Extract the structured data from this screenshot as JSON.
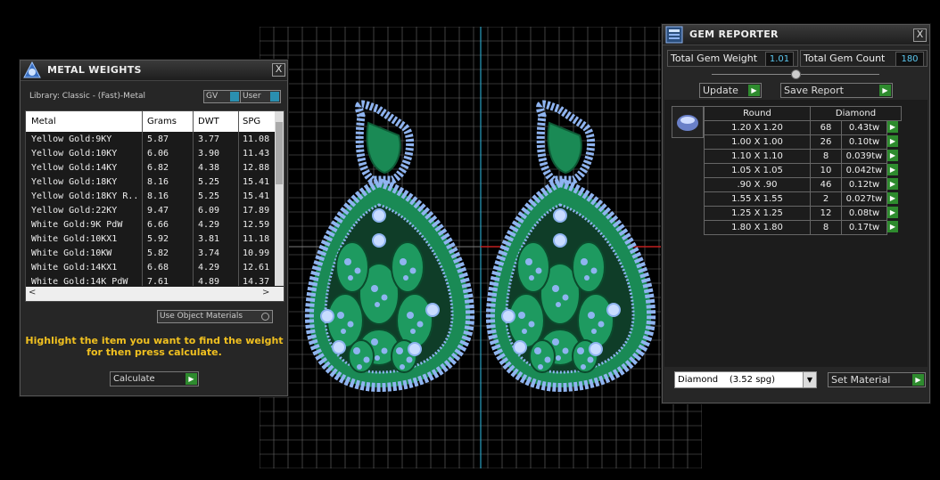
{
  "metal_weights": {
    "title": "METAL WEIGHTS",
    "close": "X",
    "library": "Library: Classic - (Fast)-Metal",
    "toggle_gv": "GV",
    "toggle_user": "User",
    "headers": [
      "Metal",
      "Grams",
      "DWT",
      "SPG"
    ],
    "rows": [
      [
        "Yellow Gold:9KY",
        "5.87",
        "3.77",
        "11.08"
      ],
      [
        "Yellow Gold:10KY",
        "6.06",
        "3.90",
        "11.43"
      ],
      [
        "Yellow Gold:14KY",
        "6.82",
        "4.38",
        "12.88"
      ],
      [
        "Yellow Gold:18KY",
        "8.16",
        "5.25",
        "15.41"
      ],
      [
        "Yellow Gold:18KY R...",
        "8.16",
        "5.25",
        "15.41"
      ],
      [
        "Yellow Gold:22KY",
        "9.47",
        "6.09",
        "17.89"
      ],
      [
        "White Gold:9K PdW",
        "6.66",
        "4.29",
        "12.59"
      ],
      [
        "White Gold:10KX1",
        "5.92",
        "3.81",
        "11.18"
      ],
      [
        "White Gold:10KW",
        "5.82",
        "3.74",
        "10.99"
      ],
      [
        "White Gold:14KX1",
        "6.68",
        "4.29",
        "12.61"
      ],
      [
        "White Gold:14K PdW",
        "7.61",
        "4.89",
        "14.37"
      ]
    ],
    "use_object_materials": "Use Object Materials",
    "hint_line1": "Highlight the item you want to find the weight",
    "hint_line2": "for then press calculate.",
    "calculate": "Calculate"
  },
  "gem_reporter": {
    "title": "GEM REPORTER",
    "close": "X",
    "total_weight_label": "Total Gem Weight",
    "total_weight_value": "1.01",
    "total_count_label": "Total Gem Count",
    "total_count_value": "180",
    "update": "Update",
    "save_report": "Save Report",
    "header_shape": "Round",
    "header_material": "Diamond",
    "rows": [
      [
        "1.20 X 1.20",
        "68",
        "0.43tw"
      ],
      [
        "1.00 X 1.00",
        "26",
        "0.10tw"
      ],
      [
        "1.10 X 1.10",
        "8",
        "0.039tw"
      ],
      [
        "1.05 X 1.05",
        "10",
        "0.042tw"
      ],
      [
        ".90 X .90",
        "46",
        "0.12tw"
      ],
      [
        "1.55 X 1.55",
        "2",
        "0.027tw"
      ],
      [
        "1.25 X 1.25",
        "12",
        "0.08tw"
      ],
      [
        "1.80 X 1.80",
        "8",
        "0.17tw"
      ]
    ],
    "material_select": "Diamond    (3.52 spg)",
    "set_material": "Set Material"
  },
  "colors": {
    "metal": "#1a8a55",
    "gem": "#8fb4f0",
    "grid": "#6a6a6a",
    "accent": "#2e8b2e",
    "value_text": "#5cc8f0",
    "hint": "#f0c020"
  },
  "icons": [
    "metal-weights-icon",
    "gem-reporter-icon",
    "gem-thumbnail-icon",
    "play-icon",
    "close-icon"
  ]
}
